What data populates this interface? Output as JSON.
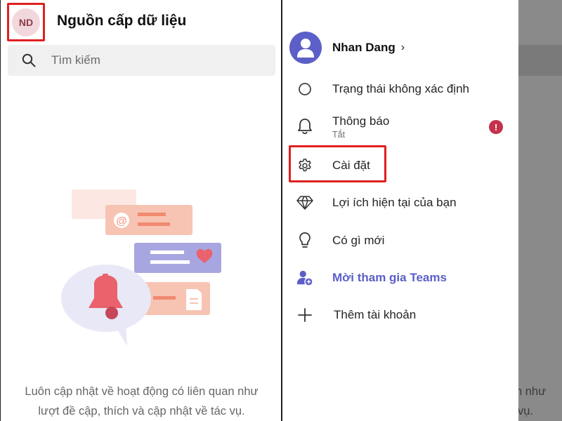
{
  "feed": {
    "avatar_initials": "ND",
    "title": "Nguồn cấp dữ liệu",
    "search_placeholder": "Tìm kiếm",
    "empty_line1": "Luôn cập nhật về hoạt động có liên quan như",
    "empty_line2": "lượt đề cập, thích và cập nhật về tác vụ."
  },
  "drawer": {
    "profile_name": "Nhan Dang",
    "profile_chevron": "›",
    "items": [
      {
        "label": "Trạng thái không xác định",
        "icon": "status-circle-icon"
      },
      {
        "label": "Thông báo",
        "sublabel": "Tắt",
        "icon": "bell-icon",
        "badge": "!"
      },
      {
        "label": "Cài đặt",
        "icon": "gear-icon"
      },
      {
        "label": "Lợi ích hiện tại của bạn",
        "icon": "diamond-icon"
      },
      {
        "label": "Có gì mới",
        "icon": "lightbulb-icon"
      },
      {
        "label": "Mời tham gia Teams",
        "icon": "add-person-icon"
      },
      {
        "label": "Thêm tài khoản",
        "icon": "plus-icon"
      }
    ]
  },
  "overlay": {
    "text_line1": "n như",
    "text_line2": "vụ."
  },
  "colors": {
    "accent": "#5b5fc7",
    "highlight": "#e02020",
    "badge": "#c4314b"
  }
}
